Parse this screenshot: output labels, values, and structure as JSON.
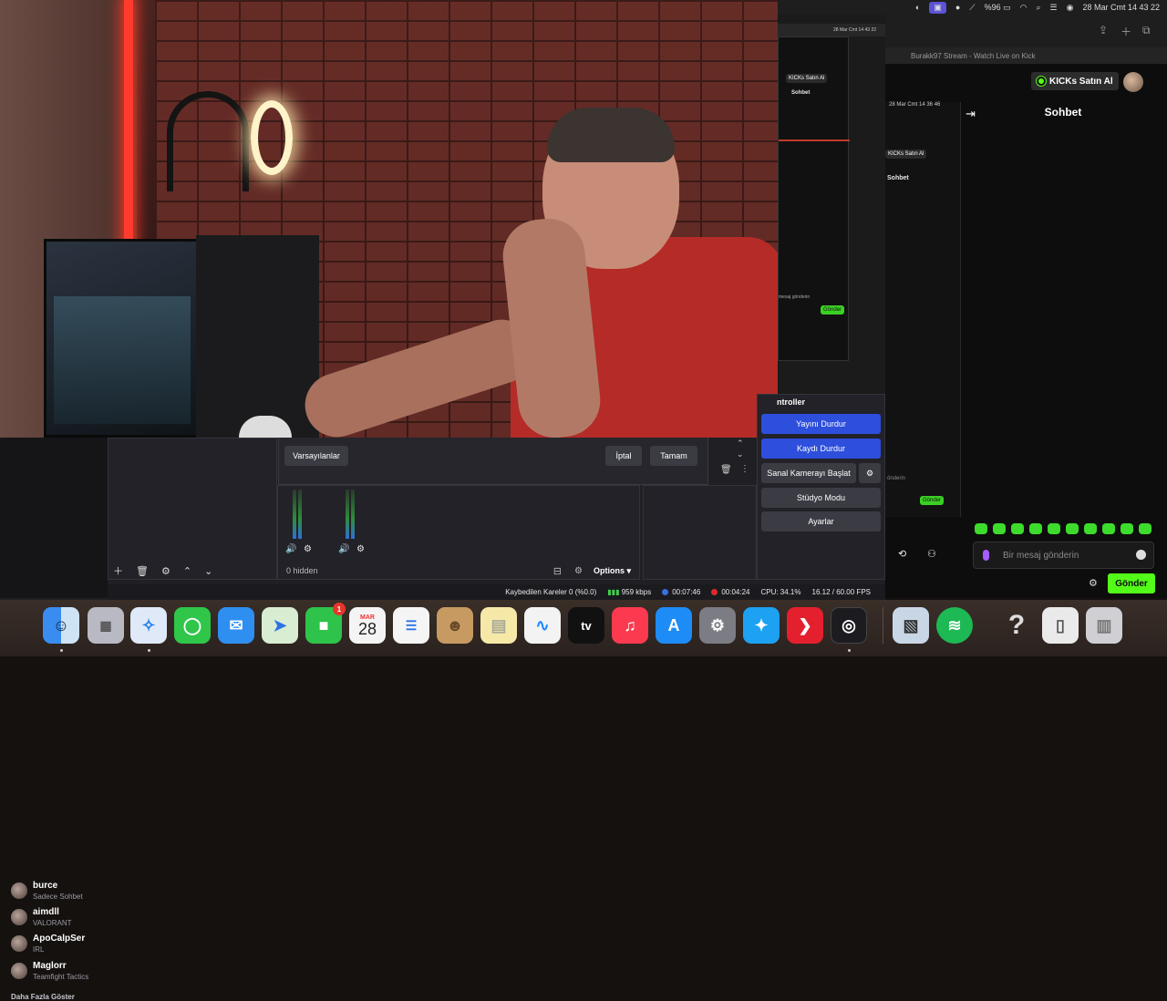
{
  "menubar": {
    "battery": "%96",
    "datetime": "28 Mar Cmt  14 43 22"
  },
  "mirror": {
    "datetime": "28 Mar Cmt  14 43 22",
    "kicks_label": "KICKs Satın Al",
    "chat_title": "Sohbet",
    "input_placeholder": "mesaj gönderin",
    "send_label": "Gönder"
  },
  "browser": {
    "tab_title": "Burakk97 Stream - Watch Live on Kick",
    "kicks_label": "KICKs Satın Al",
    "chat_title": "Sohbet",
    "input_placeholder": "Bir mesaj gönderin",
    "send_label": "Gönder",
    "accent": "#53fc18"
  },
  "mirror2": {
    "datetime": "28 Mar Cmt  14 36 46",
    "kicks_label": "KICKs Satın Al",
    "chat_title": "Sohbet",
    "input_placeholder": "önderin",
    "send_label": "Gönder"
  },
  "following": {
    "items": [
      {
        "name": "burce",
        "sub": "Sadece Sohbet"
      },
      {
        "name": "aimdll",
        "sub": "VALORANT"
      },
      {
        "name": "ApoCalpSer",
        "sub": "IRL"
      },
      {
        "name": "Maglorr",
        "sub": "Teamfight Tactics"
      }
    ],
    "show_more": "Daha Fazla Göster"
  },
  "dialog": {
    "defaults": "Varsayılanlar",
    "cancel": "İptal",
    "ok": "Tamam"
  },
  "mixer": {
    "hidden": "0 hidden",
    "options": "Options"
  },
  "controls": {
    "title": "ntroller",
    "stop_stream": "Yayını Durdur",
    "stop_record": "Kaydı Durdur",
    "virtual_cam": "Sanal Kamerayı Başlat",
    "studio_mode": "Stüdyo Modu",
    "settings": "Ayarlar"
  },
  "status": {
    "dropped": "Kaybedilen Kareler 0 (%0.0)",
    "bitrate": "959 kbps",
    "stream_time": "00:07:46",
    "record_time": "00:04:24",
    "cpu": "CPU: 34.1%",
    "fps": "16.12 / 60.00 FPS"
  },
  "dock": {
    "calendar_month": "MAR",
    "calendar_day": "28",
    "facetime_badge": "1",
    "apps": [
      "Finder",
      "Launchpad",
      "Safari",
      "Messages",
      "Mail",
      "Maps",
      "FaceTime",
      "Calendar",
      "Reminders",
      "Contacts",
      "Notes",
      "Freeform",
      "TV",
      "Music",
      "App Store",
      "System Settings",
      "Twitter",
      "Kick",
      "OBS",
      "Preview",
      "Spotify",
      "Help",
      "File",
      "Trash"
    ]
  }
}
